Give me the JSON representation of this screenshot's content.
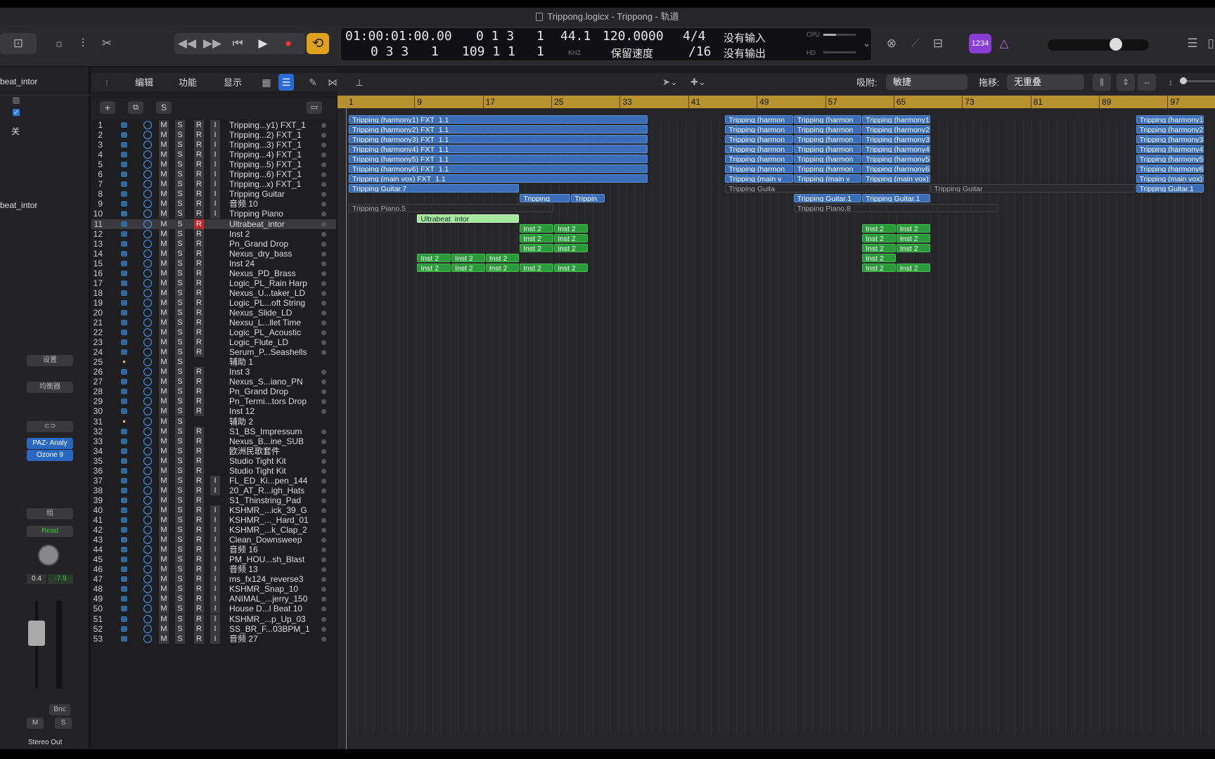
{
  "window": {
    "title": "Trippong.logicx - Trippong - 轨道"
  },
  "lcd": {
    "time_top": "01:00:01:00.00",
    "time_bottom": "0 3 3",
    "time_bottom_extra": "1",
    "beat_top": "0 1 3",
    "beat_top_extra": "1",
    "beat_bottom": "109 1 1",
    "beat_bottom_extra": "1",
    "rate": "44.1",
    "rate_unit": "KHZ",
    "tempo": "120.0000",
    "tempo_label": "保留速度",
    "sig_top": "4/4",
    "sig_bottom": "/16",
    "in": "没有输入",
    "out": "没有输出",
    "cpu": "CPU",
    "hd": "HD"
  },
  "badge": "1234",
  "toolbar": {
    "edit": "编辑",
    "func": "功能",
    "view": "显示",
    "snap_label": "吸附:",
    "snap": "敏捷",
    "drag_label": "拖移:",
    "drag": "无重叠"
  },
  "inspector": {
    "region_name": "beat_intor",
    "channel_name": "beat_intor",
    "off": "关",
    "settings": "设置",
    "eq": "均衡器",
    "plugin1": "PAZ- Analy",
    "plugin2": "Ozone 9",
    "group": "组",
    "read": "Read",
    "vol": "0.4",
    "pan": "-7.9",
    "bnc": "Bnc",
    "m": "M",
    "s": "S",
    "out": "Stereo Out"
  },
  "tracklist": {
    "add": "+",
    "s": "S"
  },
  "ruler": [
    "1",
    "9",
    "17",
    "25",
    "33",
    "41",
    "49",
    "57",
    "65",
    "73",
    "81",
    "89",
    "97"
  ],
  "tracks": [
    {
      "n": "1",
      "name": "Tripping...y1) FXT_1",
      "i": true
    },
    {
      "n": "2",
      "name": "Tripping...2) FXT_1",
      "i": true
    },
    {
      "n": "3",
      "name": "Tripping...3) FXT_1",
      "i": true
    },
    {
      "n": "4",
      "name": "Tripping...4) FXT_1",
      "i": true
    },
    {
      "n": "5",
      "name": "Tripping...5) FXT_1",
      "i": true
    },
    {
      "n": "6",
      "name": "Tripping...6) FXT_1",
      "i": true
    },
    {
      "n": "7",
      "name": "Tripping...x) FXT_1",
      "i": true
    },
    {
      "n": "8",
      "name": "Tripping Guitar",
      "i": true
    },
    {
      "n": "9",
      "name": "音频 10",
      "i": true
    },
    {
      "n": "10",
      "name": "Tripping Piano",
      "i": true
    },
    {
      "n": "11",
      "name": "Ultrabeat_intor",
      "i": false,
      "sel": true
    },
    {
      "n": "12",
      "name": "Inst 2",
      "i": false
    },
    {
      "n": "13",
      "name": "Pn_Grand Drop",
      "i": false
    },
    {
      "n": "14",
      "name": "Nexus_dry_bass",
      "i": false
    },
    {
      "n": "15",
      "name": "Inst 24",
      "i": false
    },
    {
      "n": "16",
      "name": "Nexus_PD_Brass",
      "i": false
    },
    {
      "n": "17",
      "name": "Logic_PL_Rain Harp",
      "i": false
    },
    {
      "n": "18",
      "name": "Nexus_U...taker_LD",
      "i": false
    },
    {
      "n": "19",
      "name": "Logic_PL...oft String",
      "i": false
    },
    {
      "n": "20",
      "name": "Nexus_Slide_LD",
      "i": false
    },
    {
      "n": "21",
      "name": "Nexsu_L...llet Time",
      "i": false
    },
    {
      "n": "22",
      "name": "Logic_PL_Acoustic",
      "i": false
    },
    {
      "n": "23",
      "name": "Logic_Flute_LD",
      "i": false
    },
    {
      "n": "24",
      "name": "Serum_P...Seashells",
      "i": false
    },
    {
      "n": "25",
      "name": "辅助 1",
      "i": false,
      "aux": true
    },
    {
      "n": "26",
      "name": "Inst 3",
      "i": false
    },
    {
      "n": "27",
      "name": "Nexus_S...iano_PN",
      "i": false
    },
    {
      "n": "28",
      "name": "Pn_Grand Drop",
      "i": false
    },
    {
      "n": "29",
      "name": "Pn_Termi...tors Drop",
      "i": false
    },
    {
      "n": "30",
      "name": "Inst 12",
      "i": false
    },
    {
      "n": "31",
      "name": "辅助 2",
      "i": false,
      "aux": true
    },
    {
      "n": "32",
      "name": "S1_BS_Impressum",
      "i": false
    },
    {
      "n": "33",
      "name": "Nexus_B...ine_SUB",
      "i": false
    },
    {
      "n": "34",
      "name": "欧洲民歌套件",
      "i": false
    },
    {
      "n": "35",
      "name": "Studio Tight Kit",
      "i": false
    },
    {
      "n": "36",
      "name": "Studio Tight Kit",
      "i": false
    },
    {
      "n": "37",
      "name": "FL_ED_Ki...pen_144",
      "i": true
    },
    {
      "n": "38",
      "name": "20_AT_R...igh_Hats",
      "i": true
    },
    {
      "n": "39",
      "name": "S1_Thinstring_Pad",
      "i": false
    },
    {
      "n": "40",
      "name": "KSHMR_...ick_39_G",
      "i": true
    },
    {
      "n": "41",
      "name": "KSHMR_..._Hard_01",
      "i": true
    },
    {
      "n": "42",
      "name": "KSHMR_...k_Clap_2",
      "i": true
    },
    {
      "n": "43",
      "name": "Clean_Downsweep",
      "i": true
    },
    {
      "n": "44",
      "name": "音频 16",
      "i": true
    },
    {
      "n": "45",
      "name": "PM_HOU...sh_Blast",
      "i": true
    },
    {
      "n": "46",
      "name": "音频 13",
      "i": true
    },
    {
      "n": "47",
      "name": "ms_fx124_reverse3",
      "i": true
    },
    {
      "n": "48",
      "name": "KSHMR_Snap_10",
      "i": true
    },
    {
      "n": "49",
      "name": "ANIMAL_...jerry_150",
      "i": true
    },
    {
      "n": "50",
      "name": "House D...l Beat 10",
      "i": true
    },
    {
      "n": "51",
      "name": "KSHMR_...p_Up_03",
      "i": true
    },
    {
      "n": "52",
      "name": "SS_BR_F...03BPM_1",
      "i": true
    },
    {
      "n": "53",
      "name": "音频 27",
      "i": true
    }
  ],
  "regions": [
    {
      "t": 1,
      "c": "rb",
      "a": 1,
      "b": 36,
      "l": "Tripping (harmony1) FXT_1.1"
    },
    {
      "t": 2,
      "c": "rb",
      "a": 1,
      "b": 36,
      "l": "Tripping (harmony2) FXT_1.1"
    },
    {
      "t": 3,
      "c": "rb",
      "a": 1,
      "b": 36,
      "l": "Tripping (harmony3) FXT_1.1"
    },
    {
      "t": 4,
      "c": "rb",
      "a": 1,
      "b": 36,
      "l": "Tripping (harmony4) FXT_1.1"
    },
    {
      "t": 5,
      "c": "rb",
      "a": 1,
      "b": 36,
      "l": "Tripping (harmony5) FXT_1.1"
    },
    {
      "t": 6,
      "c": "rb",
      "a": 1,
      "b": 36,
      "l": "Tripping (harmony6) FXT_1.1"
    },
    {
      "t": 7,
      "c": "rb",
      "a": 1,
      "b": 36,
      "l": "Tripping (main vox) FXT_1.1"
    },
    {
      "t": 1,
      "c": "rb",
      "a": 45,
      "b": 53,
      "l": "Tripping (harmon"
    },
    {
      "t": 1,
      "c": "rb",
      "a": 53,
      "b": 61,
      "l": "Tripping (harmon"
    },
    {
      "t": 1,
      "c": "rb",
      "a": 61,
      "b": 69,
      "l": "Tripping (harmony1"
    },
    {
      "t": 2,
      "c": "rb",
      "a": 45,
      "b": 53,
      "l": "Tripping (harmon"
    },
    {
      "t": 2,
      "c": "rb",
      "a": 53,
      "b": 61,
      "l": "Tripping (harmon"
    },
    {
      "t": 2,
      "c": "rb",
      "a": 61,
      "b": 69,
      "l": "Tripping (harmony2"
    },
    {
      "t": 3,
      "c": "rb",
      "a": 45,
      "b": 53,
      "l": "Tripping (harmon"
    },
    {
      "t": 3,
      "c": "rb",
      "a": 53,
      "b": 61,
      "l": "Tripping (harmon"
    },
    {
      "t": 3,
      "c": "rb",
      "a": 61,
      "b": 69,
      "l": "Tripping (harmony3"
    },
    {
      "t": 4,
      "c": "rb",
      "a": 45,
      "b": 53,
      "l": "Tripping (harmon"
    },
    {
      "t": 4,
      "c": "rb",
      "a": 53,
      "b": 61,
      "l": "Tripping (harmon"
    },
    {
      "t": 4,
      "c": "rb",
      "a": 61,
      "b": 69,
      "l": "Tripping (harmony4"
    },
    {
      "t": 5,
      "c": "rb",
      "a": 45,
      "b": 53,
      "l": "Tripping (harmon"
    },
    {
      "t": 5,
      "c": "rb",
      "a": 53,
      "b": 61,
      "l": "Tripping (harmon"
    },
    {
      "t": 5,
      "c": "rb",
      "a": 61,
      "b": 69,
      "l": "Tripping (harmony5"
    },
    {
      "t": 6,
      "c": "rb",
      "a": 45,
      "b": 53,
      "l": "Tripping (harmon"
    },
    {
      "t": 6,
      "c": "rb",
      "a": 53,
      "b": 61,
      "l": "Tripping (harmon"
    },
    {
      "t": 6,
      "c": "rb",
      "a": 61,
      "b": 69,
      "l": "Tripping (harmony6"
    },
    {
      "t": 7,
      "c": "rb",
      "a": 45,
      "b": 53,
      "l": "Tripping (main v"
    },
    {
      "t": 7,
      "c": "rb",
      "a": 53,
      "b": 61,
      "l": "Tripping (main v"
    },
    {
      "t": 7,
      "c": "rb",
      "a": 61,
      "b": 69,
      "l": "Tripping (main vox)"
    },
    {
      "t": 1,
      "c": "rb",
      "a": 93,
      "b": 101,
      "l": "Tripping (harmony1"
    },
    {
      "t": 2,
      "c": "rb",
      "a": 93,
      "b": 101,
      "l": "Tripping (harmony2"
    },
    {
      "t": 3,
      "c": "rb",
      "a": 93,
      "b": 101,
      "l": "Tripping (harmony3"
    },
    {
      "t": 4,
      "c": "rb",
      "a": 93,
      "b": 101,
      "l": "Tripping (harmony4"
    },
    {
      "t": 5,
      "c": "rb",
      "a": 93,
      "b": 101,
      "l": "Tripping (harmony5"
    },
    {
      "t": 6,
      "c": "rb",
      "a": 93,
      "b": 101,
      "l": "Tripping (harmony6"
    },
    {
      "t": 7,
      "c": "rb",
      "a": 93,
      "b": 101,
      "l": "Tripping (main vox)"
    },
    {
      "t": 8,
      "c": "rb",
      "a": 1,
      "b": 21,
      "l": "Tripping Guitar.7"
    },
    {
      "t": 8,
      "c": "rd",
      "a": 45,
      "b": 69,
      "l": "Tripping Guita"
    },
    {
      "t": 8,
      "c": "rd",
      "a": 69,
      "b": 93,
      "l": "Tripping Guitar"
    },
    {
      "t": 8,
      "c": "rb",
      "a": 93,
      "b": 101,
      "l": "Tripping Guitar.1"
    },
    {
      "t": 9,
      "c": "rb",
      "a": 21,
      "b": 27,
      "l": "Tripping"
    },
    {
      "t": 9,
      "c": "rb",
      "a": 27,
      "b": 31,
      "l": "Trippin"
    },
    {
      "t": 9,
      "c": "rb",
      "a": 53,
      "b": 61,
      "l": "Tripping Guitar.1"
    },
    {
      "t": 9,
      "c": "rb",
      "a": 61,
      "b": 69,
      "l": "Tripping Guitar.1"
    },
    {
      "t": 10,
      "c": "rd",
      "a": 1,
      "b": 25,
      "l": "Tripping Piano.5"
    },
    {
      "t": 10,
      "c": "rd",
      "a": 53,
      "b": 77,
      "l": "Tripping Piano.8"
    },
    {
      "t": 11,
      "c": "rgl",
      "a": 9,
      "b": 21,
      "l": "Ultrabeat_intor"
    },
    {
      "t": 12,
      "c": "rg",
      "a": 21,
      "b": 25,
      "l": "Inst 2"
    },
    {
      "t": 12,
      "c": "rg",
      "a": 25,
      "b": 29,
      "l": "Inst 2"
    },
    {
      "t": 12,
      "c": "rg",
      "a": 61,
      "b": 65,
      "l": "Inst 2"
    },
    {
      "t": 12,
      "c": "rg",
      "a": 65,
      "b": 69,
      "l": "Inst 2"
    },
    {
      "t": 13,
      "c": "rg",
      "a": 21,
      "b": 25,
      "l": "Inst 2"
    },
    {
      "t": 13,
      "c": "rg",
      "a": 25,
      "b": 29,
      "l": "Inst 2"
    },
    {
      "t": 13,
      "c": "rg",
      "a": 61,
      "b": 65,
      "l": "Inst 2"
    },
    {
      "t": 13,
      "c": "rg",
      "a": 65,
      "b": 69,
      "l": "Inst 2"
    },
    {
      "t": 14,
      "c": "rg",
      "a": 21,
      "b": 25,
      "l": "Inst 2"
    },
    {
      "t": 14,
      "c": "rg",
      "a": 25,
      "b": 29,
      "l": "Inst 2"
    },
    {
      "t": 14,
      "c": "rg",
      "a": 61,
      "b": 65,
      "l": "Inst 2"
    },
    {
      "t": 14,
      "c": "rg",
      "a": 65,
      "b": 69,
      "l": "Inst 2"
    },
    {
      "t": 15,
      "c": "rg",
      "a": 9,
      "b": 13,
      "l": "Inst 2"
    },
    {
      "t": 15,
      "c": "rg",
      "a": 13,
      "b": 17,
      "l": "Inst 2"
    },
    {
      "t": 15,
      "c": "rg",
      "a": 17,
      "b": 21,
      "l": "Inst 2"
    },
    {
      "t": 15,
      "c": "rg",
      "a": 61,
      "b": 65,
      "l": "Inst 2"
    },
    {
      "t": 16,
      "c": "rg",
      "a": 9,
      "b": 13,
      "l": "Inst 2"
    },
    {
      "t": 16,
      "c": "rg",
      "a": 13,
      "b": 17,
      "l": "Inst 2"
    },
    {
      "t": 16,
      "c": "rg",
      "a": 17,
      "b": 21,
      "l": "Inst 2"
    },
    {
      "t": 16,
      "c": "rg",
      "a": 21,
      "b": 25,
      "l": "Inst 2"
    },
    {
      "t": 16,
      "c": "rg",
      "a": 25,
      "b": 29,
      "l": "Inst 2"
    },
    {
      "t": 16,
      "c": "rg",
      "a": 61,
      "b": 65,
      "l": "Inst 2"
    },
    {
      "t": 16,
      "c": "rg",
      "a": 65,
      "b": 69,
      "l": "Inst 2"
    }
  ]
}
